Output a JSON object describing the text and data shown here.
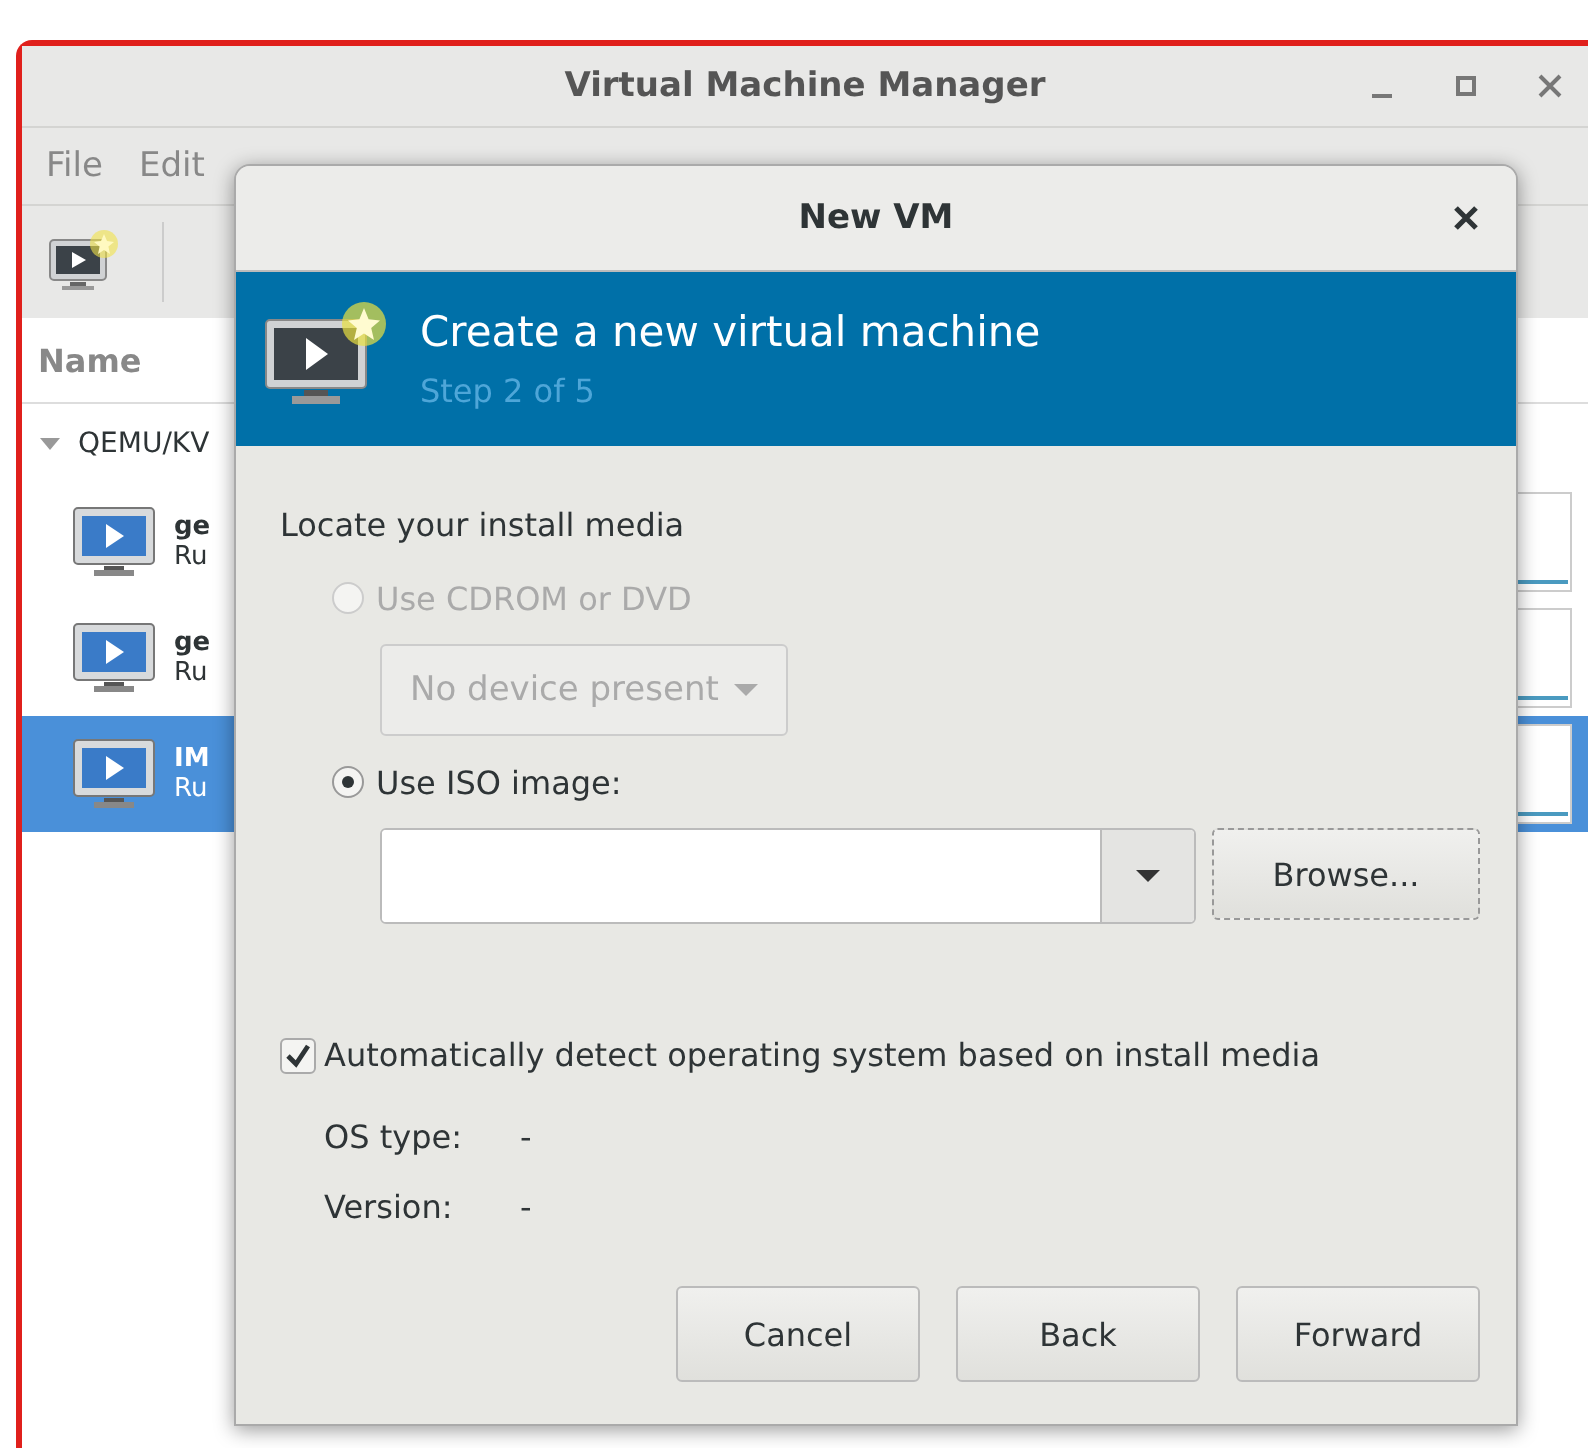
{
  "main_window": {
    "title": "Virtual Machine Manager",
    "menu": [
      "File",
      "Edit"
    ],
    "column_header": "Name",
    "connection": {
      "label": "QEMU/KV",
      "expanded": true
    },
    "vms": [
      {
        "name": "ge",
        "status": "Ru",
        "selected": false
      },
      {
        "name": "ge",
        "status": "Ru",
        "selected": false
      },
      {
        "name": "IM",
        "status": "Ru",
        "selected": true
      }
    ]
  },
  "dialog": {
    "title": "New VM",
    "header": {
      "title": "Create a new virtual machine",
      "step": "Step 2 of 5"
    },
    "section_label": "Locate your install media",
    "options": [
      {
        "label": "Use CDROM or DVD",
        "selected": false,
        "disabled": true
      },
      {
        "label": "Use ISO image:",
        "selected": true,
        "disabled": false
      }
    ],
    "cdrom_dropdown": {
      "value": "No device present",
      "disabled": true
    },
    "browse_button": "Browse...",
    "auto_detect": {
      "label": "Automatically detect operating system based on install media",
      "checked": true
    },
    "os_info": [
      {
        "label": "OS type:",
        "value": "-"
      },
      {
        "label": "Version:",
        "value": "-"
      }
    ],
    "buttons": [
      "Cancel",
      "Back",
      "Forward"
    ]
  }
}
